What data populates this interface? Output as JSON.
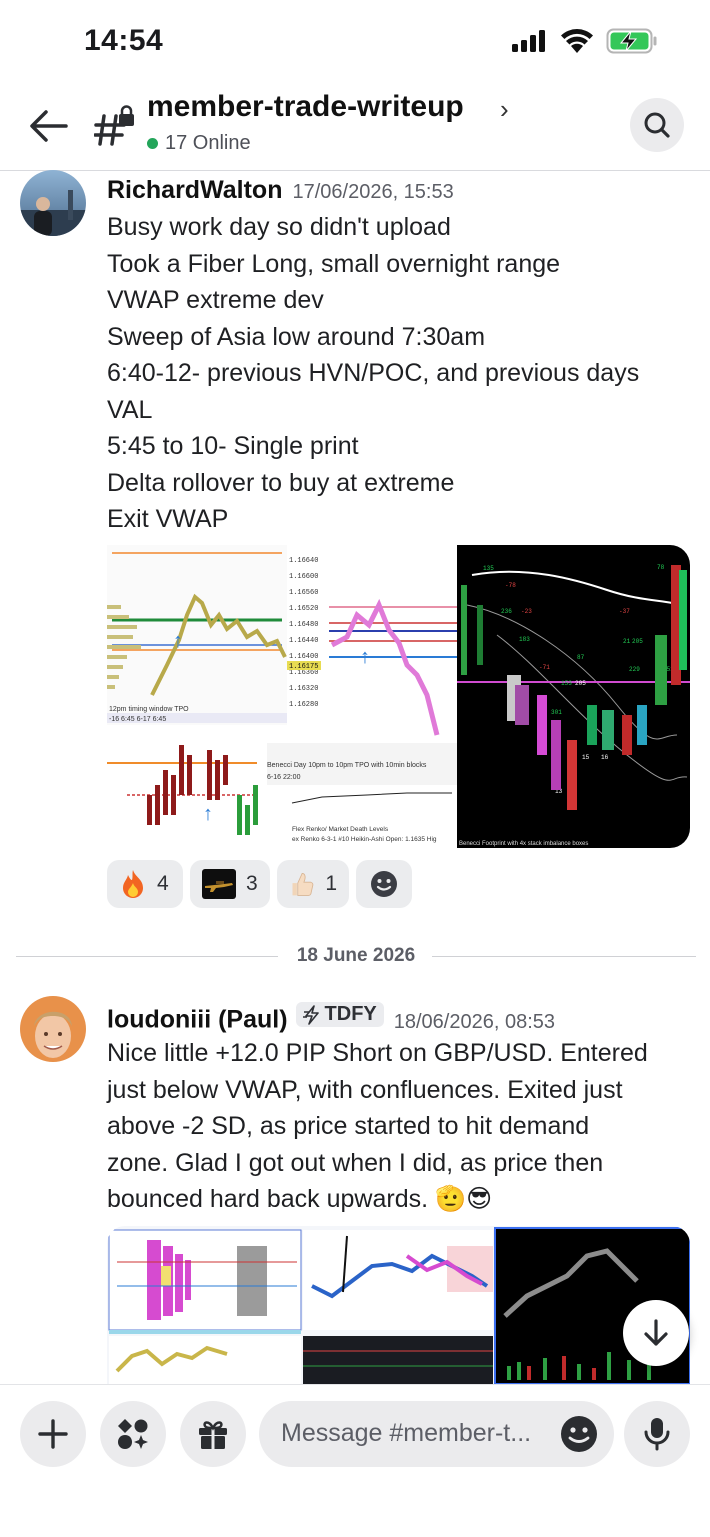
{
  "status_bar": {
    "time": "14:54"
  },
  "header": {
    "channel_name": "member-trade-writeup",
    "online": "17 Online"
  },
  "messages": [
    {
      "author": "RichardWalton",
      "timestamp": "17/06/2026, 15:53",
      "lines": [
        "Busy work day so didn't upload",
        "Took a Fiber Long, small overnight range",
        "VWAP extreme dev",
        "Sweep of Asia low around 7:30am",
        "6:40-12- previous HVN/POC, and previous days",
        "VAL",
        "5:45 to 10- Single print",
        "Delta rollover to buy at extreme",
        "Exit VWAP"
      ],
      "reactions": [
        {
          "emoji": "🔥",
          "count": "4"
        },
        {
          "emoji": "rifle",
          "count": "3"
        },
        {
          "emoji": "👍🏻",
          "count": "1"
        }
      ]
    },
    {
      "author": "loudoniii (Paul)",
      "tag": "TDFY",
      "timestamp": "18/06/2026, 08:53",
      "lines": [
        "Nice little +12.0 PIP Short on GBP/USD. Entered",
        "just below VWAP, with confluences. Exited just",
        "above -2 SD, as price started to hit demand",
        "zone. Glad I got out when I did, as price then",
        "bounced hard back upwards. 🫡😎"
      ]
    }
  ],
  "date_divider": "18 June 2026",
  "chart1": {
    "prices": [
      "1.16640",
      "1.16600",
      "1.16560",
      "1.16520",
      "1.16480",
      "1.16440",
      "1.16400",
      "1.16360",
      "1.16320",
      "1.16280"
    ],
    "current_price": "1.16175",
    "label_tpo": "12pm timing window TPO",
    "label_dates": "-16  6:45    6-17  6:45",
    "label_day": "Benecci Day 10pm to 10pm TPO with 10min blocks",
    "label_dates2": "6-16  22:00",
    "label_renko": "Flex Renko/ Market Death Levels",
    "label_renko2": "ex Renko 6-3-1 #10 Heikin-Ashi  Open: 1.1635  Hig",
    "label_footprint": "Benecci Footprint with 4x stack imbalance boxes",
    "fp_numbers": [
      "135",
      "78",
      "236",
      "-23",
      "-37",
      "183",
      "21",
      "205",
      "87",
      "229",
      "251",
      "-71",
      "153",
      "205",
      "301",
      "15",
      "16",
      "13"
    ]
  },
  "composer": {
    "placeholder": "Message #member-t..."
  },
  "colors": {
    "online": "#23a55a",
    "accent_bg": "#ebebed",
    "fire": "#f26522"
  }
}
